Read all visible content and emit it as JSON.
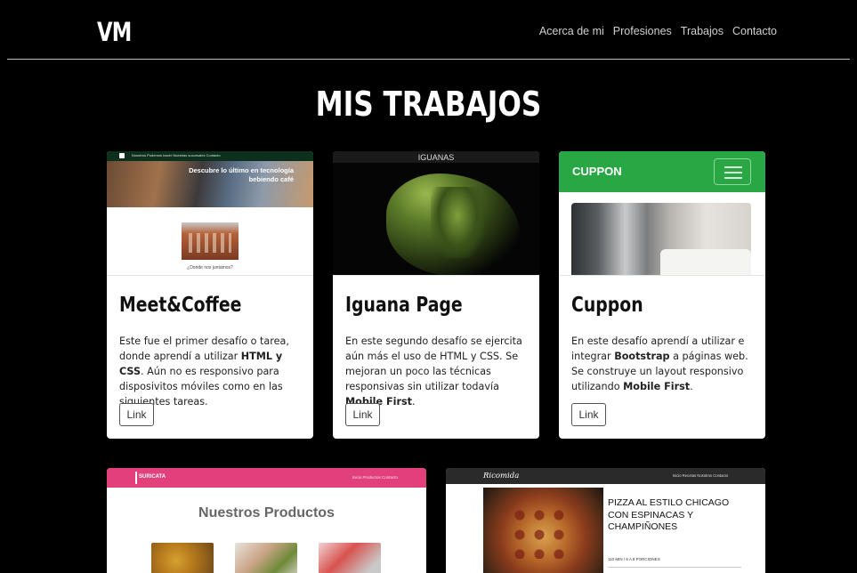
{
  "navbar": {
    "brand": "VM",
    "links": [
      "Acerca de mi",
      "Profesiones",
      "Trabajos",
      "Contacto"
    ]
  },
  "section": {
    "title": "MIS TRABAJOS"
  },
  "cards": [
    {
      "title": "Meet&Coffee",
      "desc_parts": [
        "Este fue el primer desafío o tarea, donde aprendí a utilizar ",
        "HTML y CSS",
        ". Aún no es responsivo para disposivitos móviles como en las siguientes tareas."
      ],
      "link": "Link",
      "thumb": {
        "nav": "Nosotros   Podemos hacer   Nuestras sucursales   Contacto",
        "hero": "Descubre lo último en tecnología bebiendo café",
        "caption": "¿Donde nos juntamos?"
      }
    },
    {
      "title": "Iguana Page",
      "desc_parts": [
        "En este segundo desafío se ejercita aún más el uso de HTML y CSS. Se mejoran un poco las técnicas responsivas sin utilizar todavía ",
        "Mobile First",
        "."
      ],
      "link": "Link",
      "thumb": {
        "label": "IGUANAS"
      }
    },
    {
      "title": "Cuppon",
      "desc_parts": [
        "En este desafío aprendí a utilizar e integrar ",
        "Bootstrap",
        " a páginas web. Se construye un layout responsivo utilizando ",
        "Mobile First",
        "."
      ],
      "link": "Link",
      "thumb": {
        "brand": "CUPPON"
      }
    }
  ],
  "wide_cards": [
    {
      "nav_logo": "SURICATA",
      "nav_links": "Inicio   Productos   Contacto",
      "title": "Nuestros Productos"
    },
    {
      "nav_logo": "Ricomida",
      "nav_links": "Inicio   Recetas   Nosotros   Contacto",
      "headline": "PIZZA AL ESTILO CHICAGO CON ESPINACAS Y CHAMPIÑONES",
      "sub": "110 MIN / 6 A 8 PORCIONES"
    }
  ],
  "colors": {
    "background": "#000000",
    "cuppon_green": "#29a745",
    "suricata_pink": "#e2407c"
  }
}
